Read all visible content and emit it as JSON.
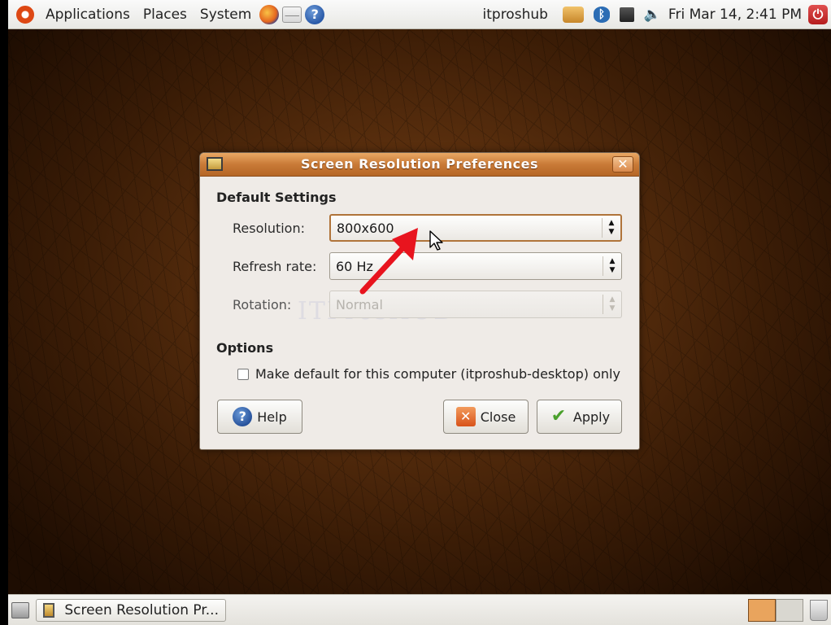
{
  "top_panel": {
    "menus": [
      "Applications",
      "Places",
      "System"
    ],
    "launchers": [
      "firefox-icon",
      "mail-icon",
      "help-icon"
    ],
    "user": "itproshub",
    "clock": "Fri Mar 14,  2:41 PM"
  },
  "dialog": {
    "title": "Screen Resolution Preferences",
    "close_glyph": "✕",
    "default_settings_heading": "Default Settings",
    "resolution": {
      "label": "Resolution:",
      "value": "800x600"
    },
    "refresh_rate": {
      "label": "Refresh rate:",
      "value": "60 Hz"
    },
    "rotation": {
      "label": "Rotation:",
      "value": "Normal"
    },
    "options_heading": "Options",
    "make_default_label": "Make default for this computer (itproshub-desktop) only",
    "make_default_checked": false,
    "buttons": {
      "help": "Help",
      "close": "Close",
      "apply": "Apply"
    },
    "watermark": "ITProsHUB"
  },
  "bottom_panel": {
    "task": "Screen Resolution Pr..."
  },
  "colors": {
    "titlebar": "#c97a37",
    "accent_orange": "#dd4814",
    "annotation_arrow": "#e8141e"
  }
}
